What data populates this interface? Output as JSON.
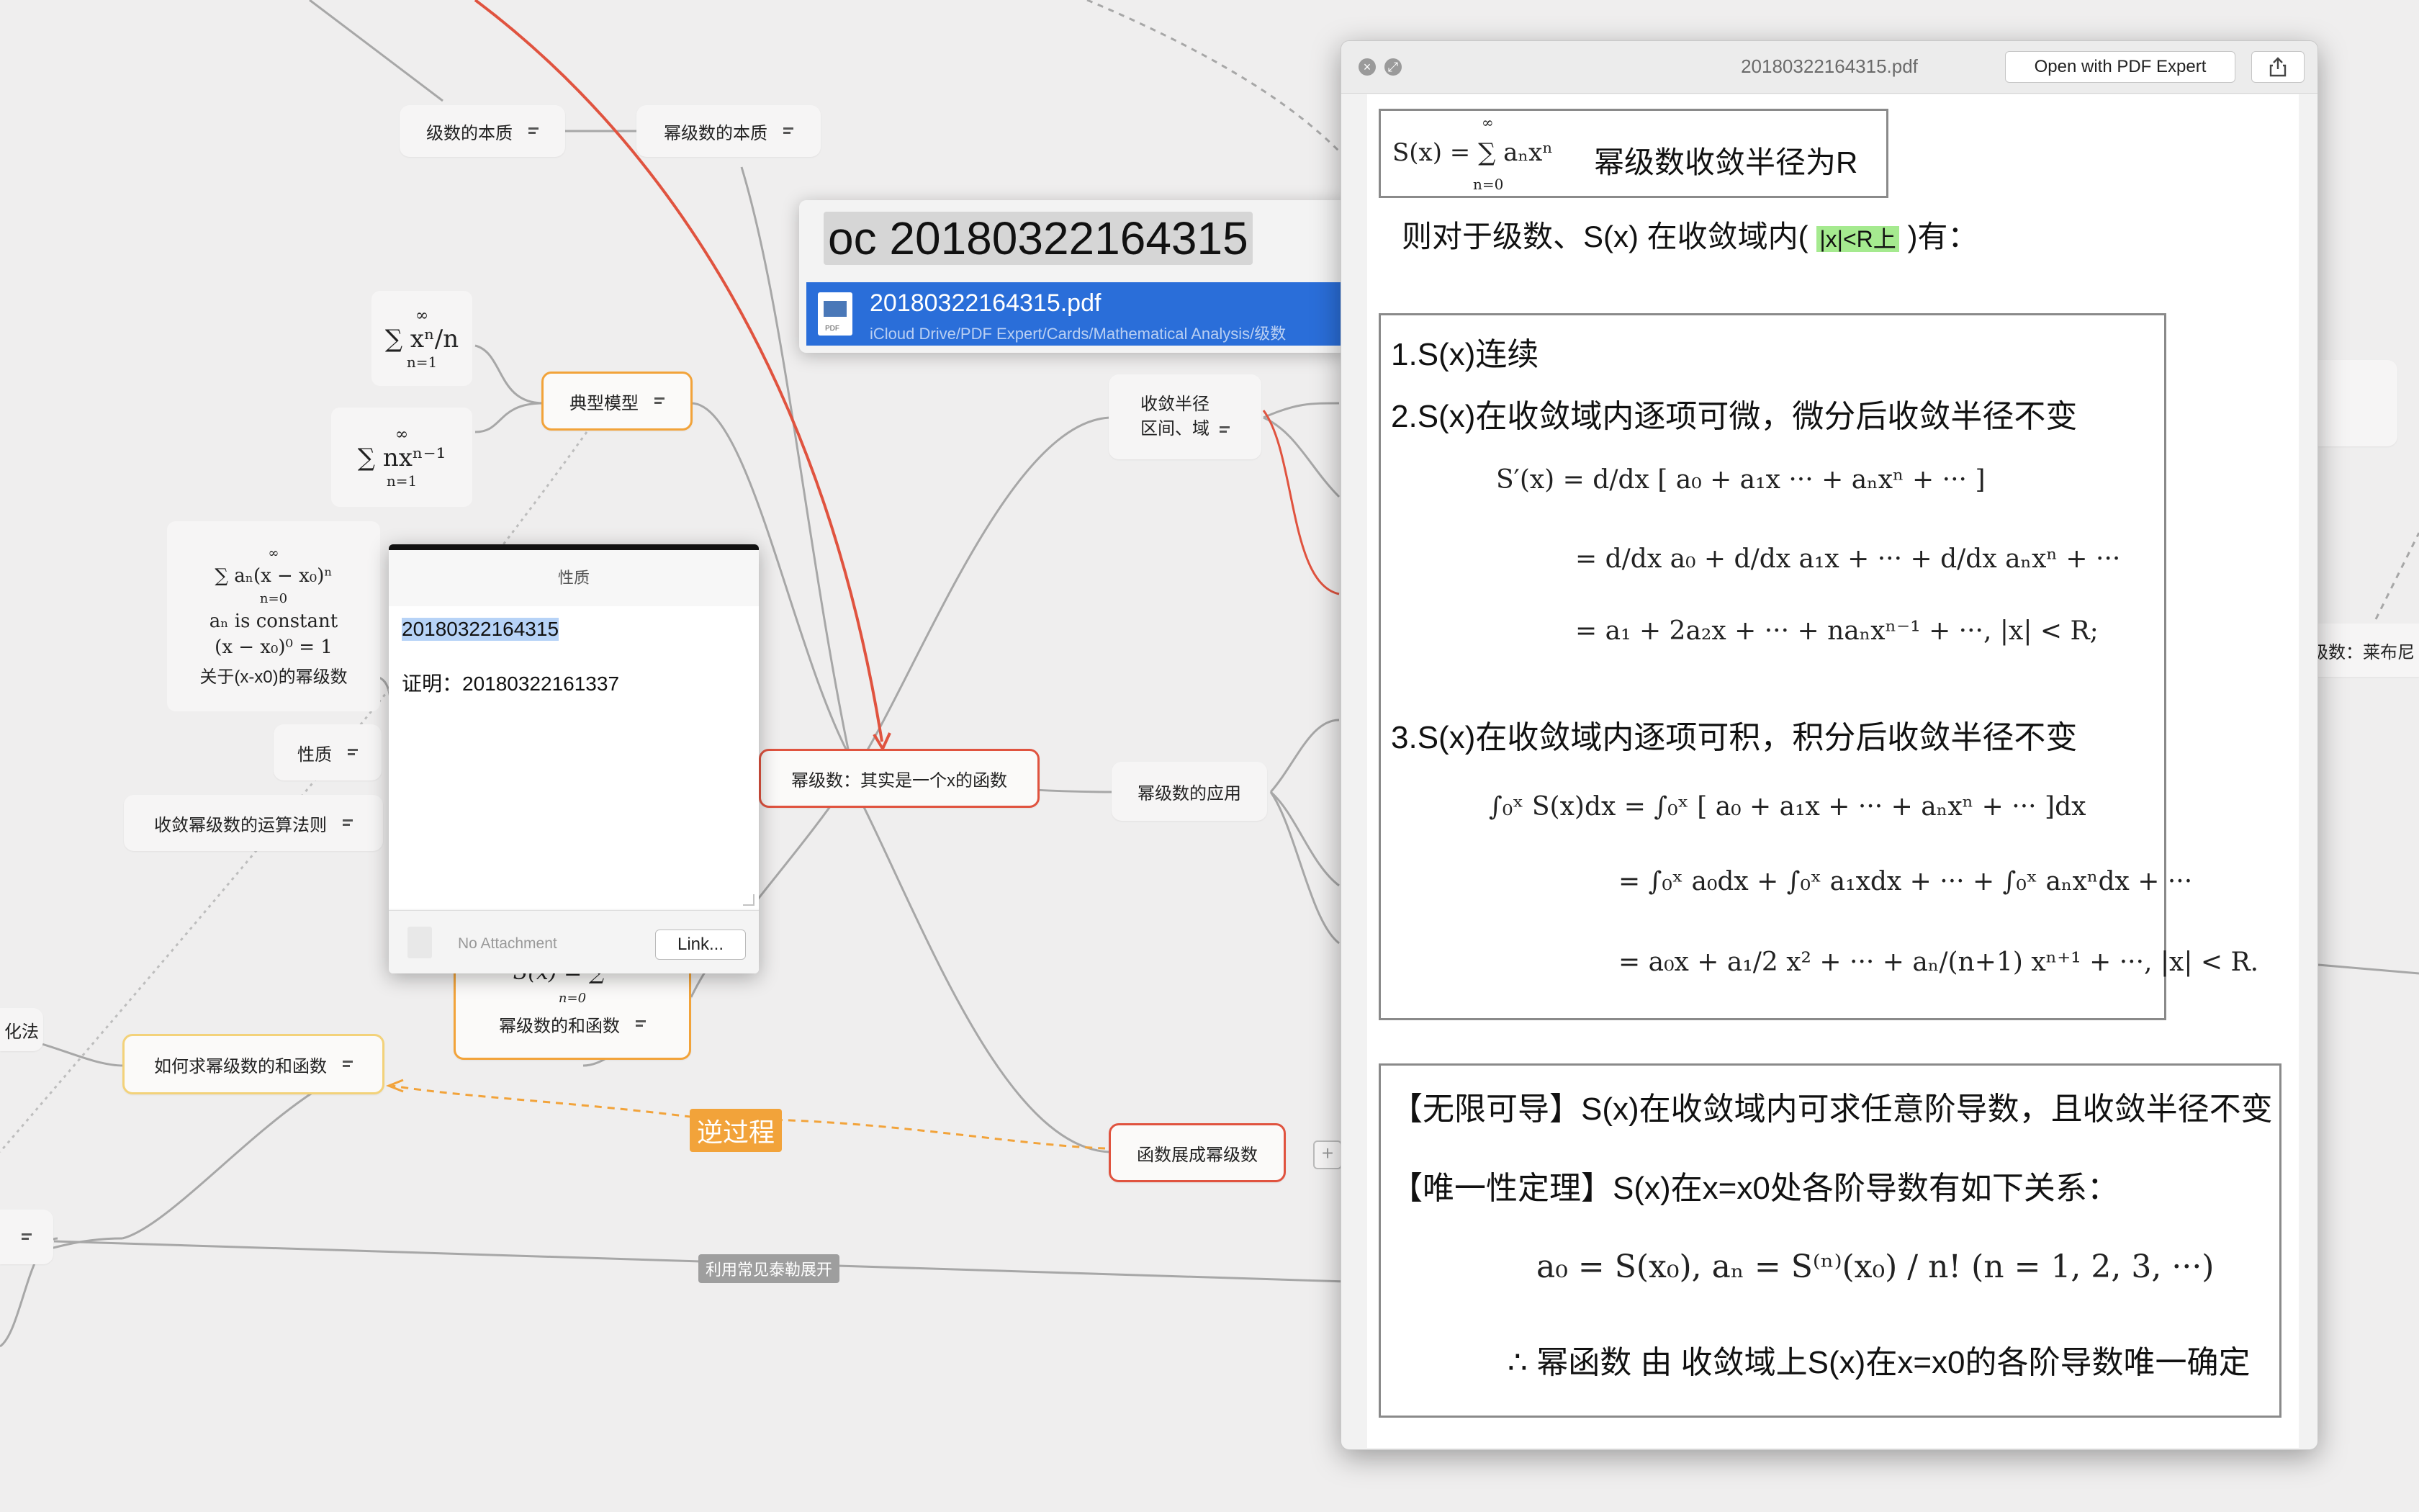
{
  "mindmap": {
    "node_jishu_benzhi": "级数的本质",
    "node_mijishu_benzhi": "幂级数的本质",
    "node_dianxing": "典型模型",
    "node_xingzhi": "性质",
    "node_yunsuan": "收敛幂级数的运算法则",
    "node_hehanshu_title": "如何求幂级数的和函数",
    "node_hehanshu": "幂级数的和函数",
    "node_central": "幂级数：其实是一个x的函数",
    "node_shoulian": [
      "收敛半径",
      "区间、域"
    ],
    "node_yingyong": "幂级数的应用",
    "node_zhankai": "函数展成幂级数",
    "node_left_partial": "化法",
    "node_right_partial": "级数：莱布尼",
    "node_right_red_partial": "!",
    "tag_reverse": "逆过程",
    "tag_taylor": "利用常见泰勒展开",
    "formula_sum_xn_n": "∑ xⁿ/n",
    "formula_sum_nxn1": "∑ nxⁿ⁻¹",
    "formula_an_lines": [
      "∑ aₙ(x − x₀)ⁿ",
      "aₙ is constant",
      "(x − x₀)⁰ = 1"
    ],
    "formula_an_caption": "关于(x-x0)的幂级数",
    "formula_sx_partial": "S(x) = ∑ ···",
    "sum_n_eq_1": "n=1",
    "sum_n_eq_0": "n=0",
    "sum_infinity": "∞"
  },
  "search": {
    "query": "oc 20180322164315",
    "result_name": "20180322164315.pdf",
    "result_path": "iCloud Drive/PDF Expert/Cards/Mathematical Analysis/级数"
  },
  "note": {
    "title": "性质",
    "line1": "20180322164315",
    "line2": "证明：20180322161337",
    "attachment": "No Attachment",
    "link_button": "Link..."
  },
  "pdf_window": {
    "title": "20180322164315.pdf",
    "open_with": "Open with PDF Expert",
    "share_icon": "share-icon"
  },
  "pdf": {
    "header_formula": "S(x) = ∑ aₙxⁿ",
    "header_sum_lower": "n=0",
    "header_sum_upper": "∞",
    "header_text": "幂级数收敛半径为R",
    "subtitle_prefix": "则对于级数、S(x)    在收敛域内(",
    "subtitle_highlight": "|x|<R上",
    "subtitle_suffix": ")有：",
    "item1": "1.S(x)连续",
    "item2": "2.S(x)在收敛域内逐项可微，微分后收敛半径不变",
    "deriv_lines": [
      "S′(x) = d/dx [ a₀ + a₁x ··· + aₙxⁿ + ··· ]",
      "= d/dx a₀ + d/dx a₁x + ··· + d/dx aₙxⁿ + ···",
      "= a₁ + 2a₂x + ··· + naₙxⁿ⁻¹ + ···,  |x| < R;"
    ],
    "item3": "3.S(x)在收敛域内逐项可积，积分后收敛半径不变",
    "integ_lines": [
      "∫₀ˣ S(x)dx  =  ∫₀ˣ [ a₀ + a₁x + ··· + aₙxⁿ + ··· ]dx",
      "= ∫₀ˣ a₀dx + ∫₀ˣ a₁xdx + ··· + ∫₀ˣ aₙxⁿdx + ···",
      "= a₀x + a₁/2 x² + ··· + aₙ/(n+1) xⁿ⁺¹ + ···,   |x| < R."
    ],
    "wuxian": "【无限可导】S(x)在收敛域内可求任意阶导数，且收敛半径不变",
    "weiyi": "【唯一性定理】S(x)在x=x0处各阶导数有如下关系：",
    "weiyi_formula": "a₀ = S(x₀),  aₙ = S⁽ⁿ⁾(x₀) / n!   (n = 1, 2, 3, ···)",
    "conclusion": "∴ 幂函数 由 收敛域上S(x)在x=x0的各阶导数唯一确定"
  },
  "colors": {
    "background": "#efeeee",
    "orange": "#f2a33a",
    "red": "#e0533f",
    "yellow": "#f3d27a",
    "selection_blue": "#2a6ed9",
    "highlight_green": "#a5ea8f"
  }
}
